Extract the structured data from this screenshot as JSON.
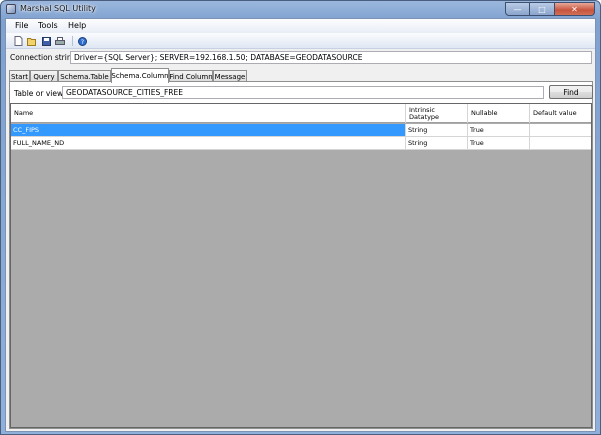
{
  "window": {
    "title": "Marshal SQL Utility"
  },
  "menu": [
    {
      "label": "File"
    },
    {
      "label": "Tools"
    },
    {
      "label": "Help"
    }
  ],
  "toolbar": {
    "icons": [
      "new-file-icon",
      "open-folder-icon",
      "save-icon",
      "print-icon",
      "help-icon"
    ]
  },
  "connection": {
    "label": "Connection string:",
    "value": "Driver={SQL Server}; SERVER=192.168.1.50; DATABASE=GEODATASOURCE"
  },
  "tabs": [
    {
      "label": "Start"
    },
    {
      "label": "Query"
    },
    {
      "label": "Schema.Table"
    },
    {
      "label": "Schema.Column",
      "active": true
    },
    {
      "label": "Find Column"
    },
    {
      "label": "Message"
    }
  ],
  "schema_column": {
    "table_label": "Table or view:",
    "table_value": "GEODATASOURCE_CITIES_FREE",
    "find_label": "Find",
    "columns": [
      "Name",
      "Intrinsic Datatype",
      "Nullable",
      "Default value"
    ],
    "rows": [
      {
        "name": "CC_FIPS",
        "datatype": "String",
        "nullable": "True",
        "default": "",
        "selected": true
      },
      {
        "name": "FULL_NAME_ND",
        "datatype": "String",
        "nullable": "True",
        "default": "",
        "selected": false
      }
    ]
  },
  "colors": {
    "selection": "#3399ff",
    "grid_background": "#ababab",
    "title_gradient": "#9bb7dd"
  }
}
